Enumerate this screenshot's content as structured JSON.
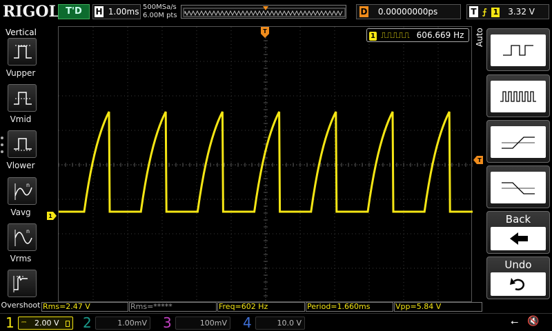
{
  "header": {
    "brand": "RIGOL",
    "run_status": "T'D",
    "horizontal": {
      "letter": "H",
      "scale": "1.00ms"
    },
    "sample_rate": "500MSa/s",
    "memory_depth": "6.00M pts",
    "delay": {
      "letter": "D",
      "value": "0.00000000ps"
    },
    "trigger": {
      "letter": "T",
      "edge_icon": "rising-edge-icon",
      "source": "1",
      "level": "3.32 V"
    }
  },
  "left_menu": {
    "title": "Vertical",
    "items": [
      {
        "label": "Vupper",
        "icon": "vupper-icon"
      },
      {
        "label": "Vmid",
        "icon": "vmid-icon"
      },
      {
        "label": "Vlower",
        "icon": "vlower-icon"
      },
      {
        "label": "Vavg",
        "icon": "vavg-icon"
      },
      {
        "label": "Vrms",
        "icon": "vrms-icon"
      },
      {
        "label": "Overshoot",
        "icon": "overshoot-icon"
      }
    ]
  },
  "screen": {
    "frequency_counter": {
      "channel": "1",
      "value": "606.669 Hz"
    },
    "trigger_mode": "Auto",
    "ch1_marker": "1",
    "waveform_color": "#f5e614"
  },
  "right_menu": {
    "items": [
      {
        "icon": "single-pulse-icon"
      },
      {
        "icon": "pulse-train-icon"
      },
      {
        "icon": "rising-ramp-icon"
      },
      {
        "icon": "falling-ramp-icon"
      },
      {
        "label": "Back",
        "icon": "back-arrow-icon"
      },
      {
        "label": "Undo",
        "icon": "undo-icon"
      }
    ]
  },
  "measurements": [
    {
      "text": "Rms=2.47 V",
      "active": true
    },
    {
      "text": "Rms=*****",
      "active": false
    },
    {
      "text": "Freq=602 Hz",
      "active": true
    },
    {
      "text": "Period=1.660ms",
      "active": true
    },
    {
      "text": "Vpp=5.84 V",
      "active": true
    }
  ],
  "channels": [
    {
      "number": "1",
      "scale": "2.00 V",
      "color": "#f5e614",
      "active": true
    },
    {
      "number": "2",
      "scale": "1.00mV",
      "color": "#1a9a8a",
      "active": false
    },
    {
      "number": "3",
      "scale": "100mV",
      "color": "#c040c0",
      "active": false
    },
    {
      "number": "4",
      "scale": "10.0 V",
      "color": "#3f6fd6",
      "active": false
    }
  ]
}
